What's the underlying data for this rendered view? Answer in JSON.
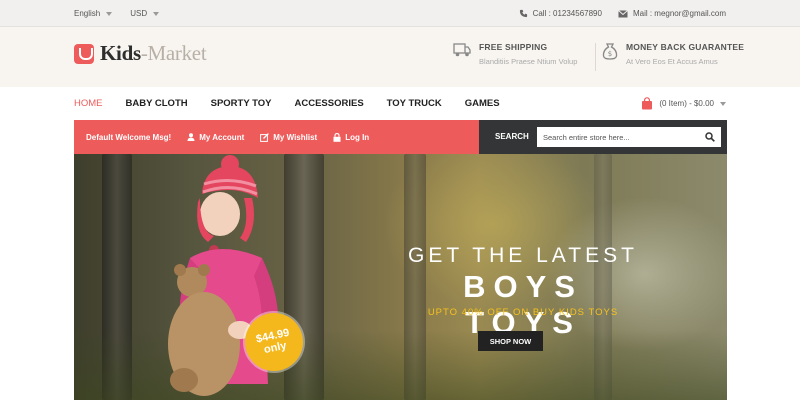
{
  "topbar": {
    "language": "English",
    "currency": "USD",
    "call": "Call : 01234567890",
    "mail": "Mail : megnor@gmail.com"
  },
  "header": {
    "logo_main": "Kids",
    "logo_accent": "-Market",
    "features": [
      {
        "title": "FREE SHIPPING",
        "subtitle": "Blanditiis Praese Ntium Volup",
        "icon": "truck-icon"
      },
      {
        "title": "MONEY BACK GUARANTEE",
        "subtitle": "At Vero Eos Et Accus Amus",
        "icon": "money-bag-icon"
      }
    ]
  },
  "nav": {
    "items": [
      "HOME",
      "BABY CLOTH",
      "SPORTY TOY",
      "ACCESSORIES",
      "TOY TRUCK",
      "GAMES"
    ],
    "cart": "(0 Item) - $0.00"
  },
  "account_bar": {
    "welcome": "Default Welcome Msg!",
    "my_account": "My Account",
    "my_wishlist": "My Wishlist",
    "login": "Log In"
  },
  "search": {
    "label": "SEARCH",
    "placeholder": "Search entire store here..."
  },
  "hero": {
    "line1": "GET THE LATEST",
    "line2": "BOYS TOYS",
    "line3": "UPTO 40% OFF ON BUY KIDS TOYS",
    "button": "SHOP NOW",
    "price": "$44.99",
    "price_note": "only"
  },
  "colors": {
    "accent": "#ee5b5b",
    "dark": "#333536",
    "badge": "#f4b81c"
  }
}
